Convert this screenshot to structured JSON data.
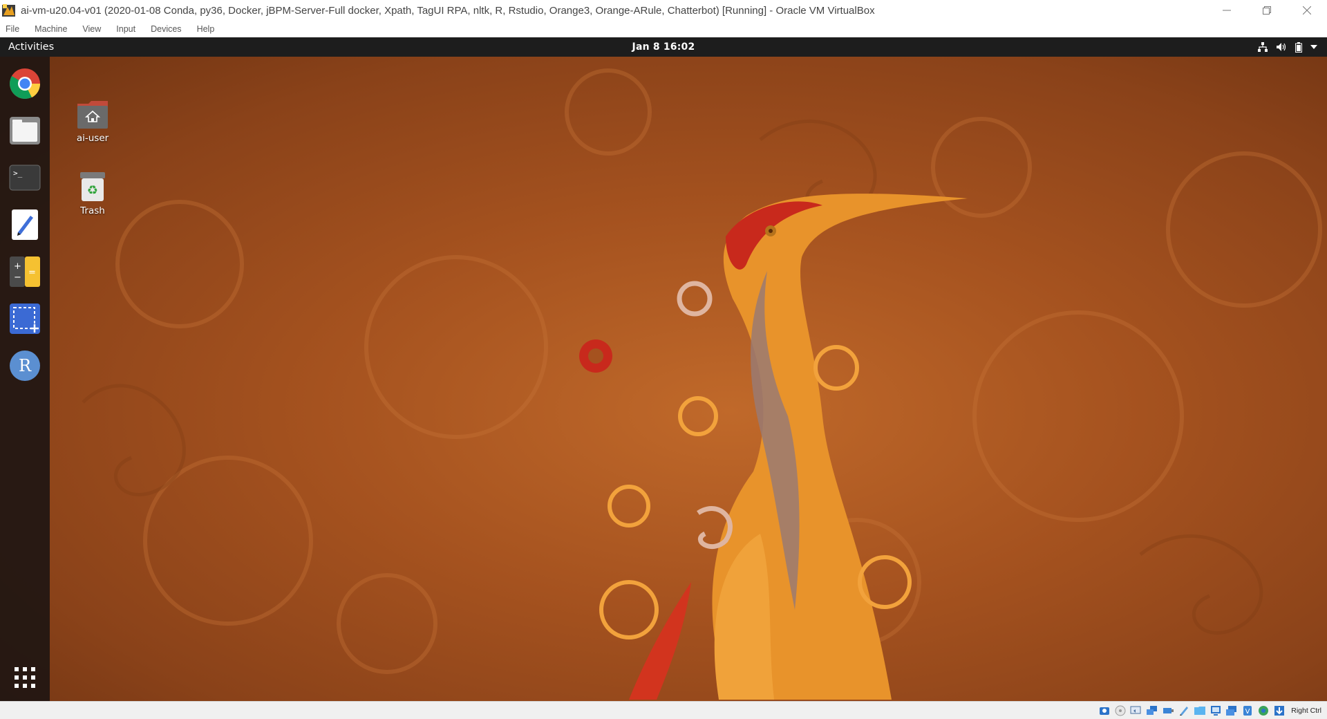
{
  "window": {
    "title": "ai-vm-u20.04-v01 (2020-01-08 Conda, py36, Docker, jBPM-Server-Full docker, Xpath, TagUI RPA, nltk, R, Rstudio, Orange3, Orange-ARule, Chatterbot) [Running] - Oracle VM VirtualBox",
    "controls": [
      "minimize-icon",
      "restore-icon",
      "close-icon"
    ]
  },
  "menubar": {
    "items": [
      "File",
      "Machine",
      "View",
      "Input",
      "Devices",
      "Help"
    ]
  },
  "topbar": {
    "activities": "Activities",
    "clock": "Jan 8  16:02",
    "tray": [
      "network-icon",
      "volume-icon",
      "battery-icon",
      "system-menu-arrow-icon"
    ]
  },
  "dock": {
    "items": [
      {
        "name": "Google Chrome",
        "icon": "chrome-icon"
      },
      {
        "name": "Files",
        "icon": "files-icon"
      },
      {
        "name": "Terminal",
        "icon": "terminal-icon"
      },
      {
        "name": "Text Editor",
        "icon": "text-editor-icon"
      },
      {
        "name": "Calculator",
        "icon": "calculator-icon"
      },
      {
        "name": "Screenshot",
        "icon": "screenshot-icon"
      },
      {
        "name": "R",
        "icon": "r-icon"
      }
    ],
    "show_apps": "show-applications-icon"
  },
  "desktop_icons": [
    {
      "label": "ai-user",
      "icon": "home-folder-icon"
    },
    {
      "label": "Trash",
      "icon": "trash-icon"
    }
  ],
  "statusbar": {
    "host_key": "Right Ctrl",
    "icons": [
      "hard-disk-icon",
      "optical-drive-icon",
      "audio-icon",
      "network-icon",
      "usb-icon",
      "shared-folders-icon",
      "display-icon",
      "recording-icon",
      "cpu-icon",
      "mouse-integration-icon",
      "host-key-icon"
    ]
  },
  "colors": {
    "topbar": "#1d1d1d",
    "desktop_base": "#a5521f",
    "dock": "#201612",
    "r_icon": "#5b8fd1"
  }
}
